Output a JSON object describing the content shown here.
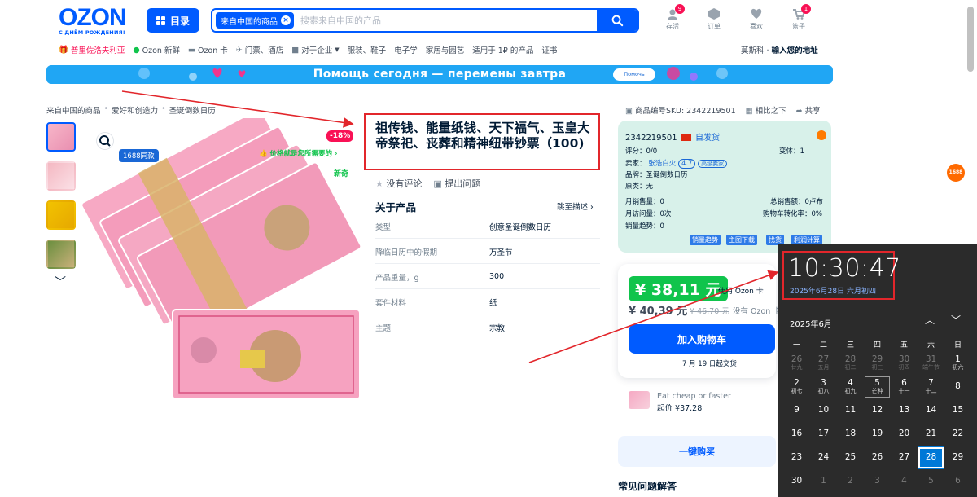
{
  "header": {
    "logo": "OZON",
    "logo_sub": "С ДНЁМ РОЖДЕНИЯ!",
    "catalog_label": "目录",
    "search_chip": "来自中国的商品",
    "search_placeholder": "搜索来自中国的产品",
    "icons": [
      {
        "label": "存活",
        "badge": "9",
        "icon": "saved-icon"
      },
      {
        "label": "订单",
        "badge": "",
        "icon": "box-icon"
      },
      {
        "label": "喜欢",
        "badge": "",
        "icon": "heart-icon"
      },
      {
        "label": "篮子",
        "badge": "1",
        "icon": "cart-icon"
      }
    ]
  },
  "subnav": {
    "items": [
      "普里佐洛夫利亚",
      "Ozon 新鲜",
      "Ozon 卡",
      "门票、酒店",
      "对于企业",
      "服装、鞋子",
      "电子学",
      "家居与园艺",
      "适用于 1₽ 的产品",
      "证书"
    ],
    "location_city": "莫斯科 · ",
    "location_action": "输入您的地址"
  },
  "banner": {
    "text": "Помощь сегодня — перемены завтра",
    "button": "Помочь"
  },
  "breadcrumbs": [
    "来自中国的商品",
    "爱好和创造力",
    "圣诞倒数日历"
  ],
  "gallery": {
    "discount": "-18%",
    "price_tag": "价格就是您所需要的",
    "new_tag": "新奇",
    "similar_badge": "1688同款"
  },
  "product": {
    "title": "祖传钱、能量纸钱、天下福气、玉皇大帝祭祀、丧葬和精神纽带钞票（100)",
    "no_reviews": "没有评论",
    "ask": "提出问题",
    "about": "关于产品",
    "jump": "跳至描述",
    "specs": [
      {
        "k": "类型",
        "v": "创意圣诞倒数日历"
      },
      {
        "k": "降临日历中的假期",
        "v": "万圣节"
      },
      {
        "k": "产品重量，g",
        "v": "300"
      },
      {
        "k": "套件材料",
        "v": "纸"
      },
      {
        "k": "主题",
        "v": "宗教"
      }
    ]
  },
  "sku_bar": {
    "sku": "商品编号SKU:  2342219501",
    "compare": "相比之下",
    "share": "共享"
  },
  "seller_panel": {
    "id": "2342219501",
    "self_ship": "自发货",
    "rating": "评分：0/0",
    "variants": "变体：1",
    "seller_prefix": "卖家：",
    "seller_name": "张浩白火",
    "seller_score": "4.7",
    "seller_tag": "高级卖家",
    "brand": "品牌：圣诞倒数日历",
    "origin": "原类：无",
    "monthly_sales": "月销售量：0",
    "total_sales": "总销售额：0卢布",
    "monthly_visits": "月访问量：0次",
    "cart_conv": "购物车转化率：0%",
    "sales_trend": "销量趋势：0",
    "buttons": [
      "销量趋势",
      "主图下载",
      "找货",
      "利润计算"
    ]
  },
  "price": {
    "card_price": "¥ 38,11 元",
    "with_card": "使用 Ozon 卡",
    "regular": "¥ 40,39 元",
    "old": "¥ 46,70 元",
    "no_card": "没有 Ozon 卡",
    "add_to_cart": "加入购物车",
    "delivery": "7 月 19 日起交货"
  },
  "cheap": {
    "line1": "Eat cheap or faster",
    "line2": "起价 ¥37.28"
  },
  "one_click": "一键购买",
  "faq": "常见问题解答",
  "ali": "1688",
  "calendar": {
    "time": "10:30:47",
    "date": "2025年6月28日 六月初四",
    "month": "2025年6月",
    "weekdays": [
      "一",
      "二",
      "三",
      "四",
      "五",
      "六",
      "日"
    ],
    "rows": [
      [
        {
          "d": "26",
          "l": "廿九",
          "dim": true
        },
        {
          "d": "27",
          "l": "五月",
          "dim": true
        },
        {
          "d": "28",
          "l": "初二",
          "dim": true
        },
        {
          "d": "29",
          "l": "初三",
          "dim": true
        },
        {
          "d": "30",
          "l": "初四",
          "dim": true
        },
        {
          "d": "31",
          "l": "端午节",
          "dim": true
        },
        {
          "d": "1",
          "l": "初六"
        }
      ],
      [
        {
          "d": "2",
          "l": "初七"
        },
        {
          "d": "3",
          "l": "初八"
        },
        {
          "d": "4",
          "l": "初九"
        },
        {
          "d": "5",
          "l": "芒种",
          "hol": true
        },
        {
          "d": "6",
          "l": "十一"
        },
        {
          "d": "7",
          "l": "十二"
        },
        {
          "d": "8",
          "l": ""
        }
      ],
      [
        {
          "d": "9",
          "l": ""
        },
        {
          "d": "10",
          "l": ""
        },
        {
          "d": "11",
          "l": ""
        },
        {
          "d": "12",
          "l": ""
        },
        {
          "d": "13",
          "l": ""
        },
        {
          "d": "14",
          "l": ""
        },
        {
          "d": "15",
          "l": ""
        }
      ],
      [
        {
          "d": "16",
          "l": ""
        },
        {
          "d": "17",
          "l": ""
        },
        {
          "d": "18",
          "l": ""
        },
        {
          "d": "19",
          "l": ""
        },
        {
          "d": "20",
          "l": ""
        },
        {
          "d": "21",
          "l": ""
        },
        {
          "d": "22",
          "l": ""
        }
      ],
      [
        {
          "d": "23",
          "l": ""
        },
        {
          "d": "24",
          "l": ""
        },
        {
          "d": "25",
          "l": ""
        },
        {
          "d": "26",
          "l": ""
        },
        {
          "d": "27",
          "l": ""
        },
        {
          "d": "28",
          "l": "",
          "today": true
        },
        {
          "d": "29",
          "l": ""
        }
      ],
      [
        {
          "d": "30",
          "l": ""
        },
        {
          "d": "1",
          "l": "",
          "dim": true
        },
        {
          "d": "2",
          "l": "",
          "dim": true
        },
        {
          "d": "3",
          "l": "",
          "dim": true
        },
        {
          "d": "4",
          "l": "",
          "dim": true
        },
        {
          "d": "5",
          "l": "",
          "dim": true
        },
        {
          "d": "6",
          "l": "",
          "dim": true
        }
      ]
    ]
  },
  "colors": {
    "brand": "#005bff",
    "accent_red": "#f91155",
    "green": "#10c44c",
    "annotation": "#e2262b"
  }
}
